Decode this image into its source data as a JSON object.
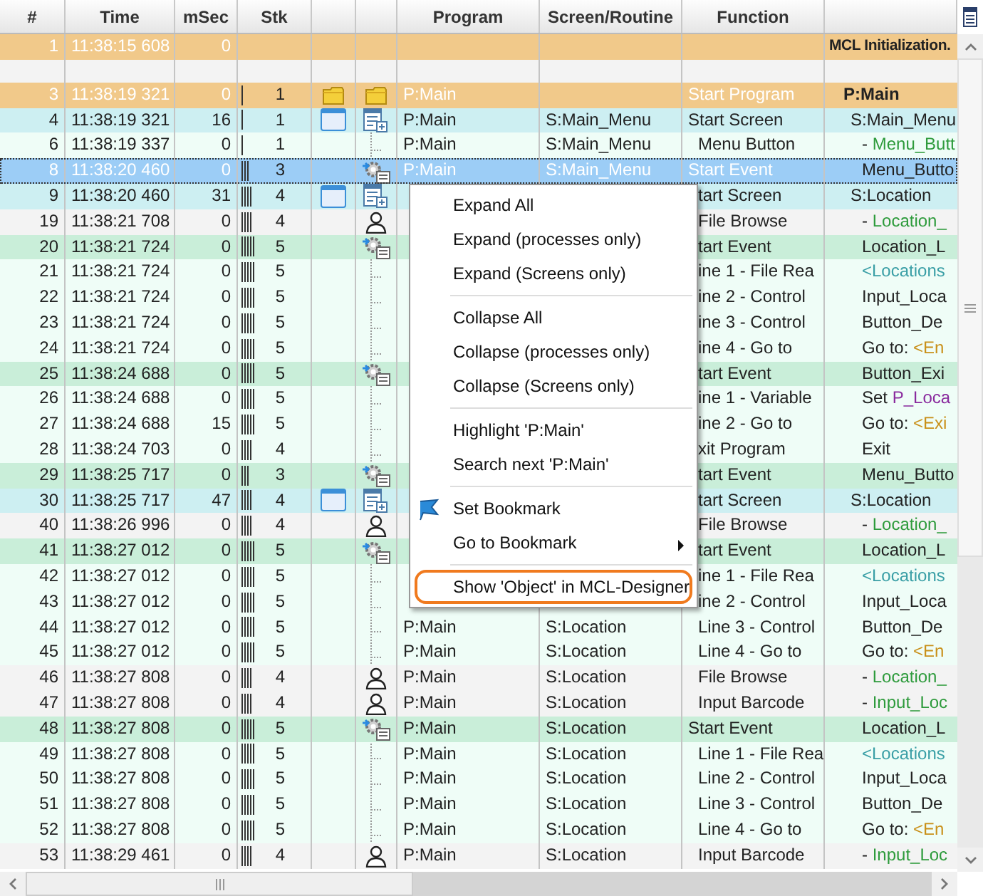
{
  "columns": [
    "#",
    "Time",
    "mSec",
    "Stk",
    "Program",
    "Screen/Routine",
    "Function"
  ],
  "rows": [
    {
      "kind": "init",
      "selected": false,
      "num": "1",
      "time": "11:38:15 608",
      "msec": "0",
      "detail": [
        {
          "text": "MCL Initialization."
        }
      ]
    },
    {
      "kind": "blank",
      "selected": false
    },
    {
      "kind": "program",
      "selected": false,
      "num": "3",
      "time": "11:38:19 321",
      "msec": "0",
      "stk": "1",
      "program": "P:Main",
      "function": {
        "text": "Start Program",
        "indented": false
      },
      "detail": [
        {
          "text": "P:Main"
        }
      ]
    },
    {
      "kind": "screen",
      "selected": false,
      "num": "4",
      "time": "11:38:19 321",
      "msec": "16",
      "stk": "1",
      "program": "P:Main",
      "screen": "S:Main_Menu",
      "function": {
        "text": "Start Screen",
        "indented": false
      },
      "detail": [
        {
          "text": "S:Main_Menu"
        }
      ]
    },
    {
      "kind": "plain",
      "selected": false,
      "num": "6",
      "time": "11:38:19 337",
      "msec": "0",
      "stk": "1",
      "program": "P:Main",
      "screen": "S:Main_Menu",
      "function": {
        "text": "Menu Button",
        "indented": true
      },
      "detail": [
        {
          "text": "- "
        },
        {
          "text": "Menu_Butt",
          "kind": "name"
        }
      ]
    },
    {
      "kind": "event",
      "selected": true,
      "num": "8",
      "time": "11:38:20 460",
      "msec": "0",
      "stk": "3",
      "program": "P:Main",
      "screen": "S:Main_Menu",
      "function": {
        "text": "Start Event",
        "indented": false
      },
      "detail": [
        {
          "text": "Menu_Butto"
        }
      ]
    },
    {
      "kind": "screen",
      "selected": false,
      "num": "9",
      "time": "11:38:20 460",
      "msec": "31",
      "stk": "4",
      "function": {
        "text": "tart Screen",
        "indented": true
      },
      "detail": [
        {
          "text": "S:Location"
        }
      ]
    },
    {
      "kind": "input",
      "selected": false,
      "num": "19",
      "time": "11:38:21 708",
      "msec": "0",
      "stk": "4",
      "function": {
        "text": "File Browse",
        "indented": true
      },
      "detail": [
        {
          "text": "- "
        },
        {
          "text": "Location_",
          "kind": "name"
        }
      ]
    },
    {
      "kind": "event",
      "selected": false,
      "num": "20",
      "time": "11:38:21 724",
      "msec": "0",
      "stk": "5",
      "function": {
        "text": "tart Event",
        "indented": true
      },
      "detail": [
        {
          "text": "Location_L"
        }
      ]
    },
    {
      "kind": "plain",
      "selected": false,
      "num": "21",
      "time": "11:38:21 724",
      "msec": "0",
      "stk": "5",
      "function": {
        "text": "ine 1 - File Rea",
        "indented": true
      },
      "detail": [
        {
          "text": "<Locations",
          "kind": "list"
        }
      ]
    },
    {
      "kind": "plain",
      "selected": false,
      "num": "22",
      "time": "11:38:21 724",
      "msec": "0",
      "stk": "5",
      "function": {
        "text": "ine 2 - Control",
        "indented": true
      },
      "detail": [
        {
          "text": "Input_Loca"
        }
      ]
    },
    {
      "kind": "plain",
      "selected": false,
      "num": "23",
      "time": "11:38:21 724",
      "msec": "0",
      "stk": "5",
      "function": {
        "text": "ine 3 - Control",
        "indented": true
      },
      "detail": [
        {
          "text": "Button_De"
        }
      ]
    },
    {
      "kind": "plain",
      "selected": false,
      "num": "24",
      "time": "11:38:21 724",
      "msec": "0",
      "stk": "5",
      "function": {
        "text": "ine 4 - Go to",
        "indented": true
      },
      "detail": [
        {
          "text": "Go to: "
        },
        {
          "text": "<En",
          "kind": "target"
        }
      ]
    },
    {
      "kind": "event",
      "selected": false,
      "num": "25",
      "time": "11:38:24 688",
      "msec": "0",
      "stk": "5",
      "function": {
        "text": "tart Event",
        "indented": true
      },
      "detail": [
        {
          "text": "Button_Exi"
        }
      ]
    },
    {
      "kind": "plain",
      "selected": false,
      "num": "26",
      "time": "11:38:24 688",
      "msec": "0",
      "stk": "5",
      "function": {
        "text": "ine 1 - Variable",
        "indented": true
      },
      "detail": [
        {
          "text": "Set "
        },
        {
          "text": "P_Loca",
          "kind": "variable"
        }
      ]
    },
    {
      "kind": "plain",
      "selected": false,
      "num": "27",
      "time": "11:38:24 688",
      "msec": "15",
      "stk": "5",
      "function": {
        "text": "ine 2 - Go to",
        "indented": true
      },
      "detail": [
        {
          "text": "Go to: "
        },
        {
          "text": "<Exi",
          "kind": "target"
        }
      ]
    },
    {
      "kind": "plain",
      "selected": false,
      "num": "28",
      "time": "11:38:24 703",
      "msec": "0",
      "stk": "4",
      "function": {
        "text": "xit Program",
        "indented": true
      },
      "detail": [
        {
          "text": "Exit"
        }
      ]
    },
    {
      "kind": "event",
      "selected": false,
      "num": "29",
      "time": "11:38:25 717",
      "msec": "0",
      "stk": "3",
      "function": {
        "text": "tart Event",
        "indented": true
      },
      "detail": [
        {
          "text": "Menu_Butto"
        }
      ]
    },
    {
      "kind": "screen",
      "selected": false,
      "num": "30",
      "time": "11:38:25 717",
      "msec": "47",
      "stk": "4",
      "function": {
        "text": "tart Screen",
        "indented": true
      },
      "detail": [
        {
          "text": "S:Location"
        }
      ]
    },
    {
      "kind": "input",
      "selected": false,
      "num": "40",
      "time": "11:38:26 996",
      "msec": "0",
      "stk": "4",
      "function": {
        "text": "File Browse",
        "indented": true
      },
      "detail": [
        {
          "text": "- "
        },
        {
          "text": "Location_",
          "kind": "name"
        }
      ]
    },
    {
      "kind": "event",
      "selected": false,
      "num": "41",
      "time": "11:38:27 012",
      "msec": "0",
      "stk": "5",
      "function": {
        "text": "tart Event",
        "indented": true
      },
      "detail": [
        {
          "text": "Location_L"
        }
      ]
    },
    {
      "kind": "plain",
      "selected": false,
      "num": "42",
      "time": "11:38:27 012",
      "msec": "0",
      "stk": "5",
      "function": {
        "text": "ine 1 - File Rea",
        "indented": true
      },
      "detail": [
        {
          "text": "<Locations",
          "kind": "list"
        }
      ]
    },
    {
      "kind": "plain",
      "selected": false,
      "num": "43",
      "time": "11:38:27 012",
      "msec": "0",
      "stk": "5",
      "function": {
        "text": "ine 2 - Control",
        "indented": true
      },
      "detail": [
        {
          "text": "Input_Loca"
        }
      ]
    },
    {
      "kind": "plain",
      "selected": false,
      "num": "44",
      "time": "11:38:27 012",
      "msec": "0",
      "stk": "5",
      "program": "P:Main",
      "screen": "S:Location",
      "function": {
        "text": "Line 3 - Control",
        "indented": true
      },
      "detail": [
        {
          "text": "Button_De"
        }
      ]
    },
    {
      "kind": "plain",
      "selected": false,
      "num": "45",
      "time": "11:38:27 012",
      "msec": "0",
      "stk": "5",
      "program": "P:Main",
      "screen": "S:Location",
      "function": {
        "text": "Line 4 - Go to",
        "indented": true
      },
      "detail": [
        {
          "text": "Go to: "
        },
        {
          "text": "<En",
          "kind": "target"
        }
      ]
    },
    {
      "kind": "input",
      "selected": false,
      "num": "46",
      "time": "11:38:27 808",
      "msec": "0",
      "stk": "4",
      "program": "P:Main",
      "screen": "S:Location",
      "function": {
        "text": "File Browse",
        "indented": true
      },
      "detail": [
        {
          "text": "- "
        },
        {
          "text": "Location_",
          "kind": "name"
        }
      ]
    },
    {
      "kind": "input",
      "selected": false,
      "num": "47",
      "time": "11:38:27 808",
      "msec": "0",
      "stk": "4",
      "program": "P:Main",
      "screen": "S:Location",
      "function": {
        "text": "Input Barcode",
        "indented": true
      },
      "detail": [
        {
          "text": "- "
        },
        {
          "text": "Input_Loc",
          "kind": "name"
        }
      ]
    },
    {
      "kind": "event",
      "selected": false,
      "num": "48",
      "time": "11:38:27 808",
      "msec": "0",
      "stk": "5",
      "program": "P:Main",
      "screen": "S:Location",
      "function": {
        "text": "Start Event",
        "indented": false
      },
      "detail": [
        {
          "text": "Location_L"
        }
      ]
    },
    {
      "kind": "plain",
      "selected": false,
      "num": "49",
      "time": "11:38:27 808",
      "msec": "0",
      "stk": "5",
      "program": "P:Main",
      "screen": "S:Location",
      "function": {
        "text": "Line 1 - File Rea",
        "indented": true
      },
      "detail": [
        {
          "text": "<Locations",
          "kind": "list"
        }
      ]
    },
    {
      "kind": "plain",
      "selected": false,
      "num": "50",
      "time": "11:38:27 808",
      "msec": "0",
      "stk": "5",
      "program": "P:Main",
      "screen": "S:Location",
      "function": {
        "text": "Line 2 - Control",
        "indented": true
      },
      "detail": [
        {
          "text": "Input_Loca"
        }
      ]
    },
    {
      "kind": "plain",
      "selected": false,
      "num": "51",
      "time": "11:38:27 808",
      "msec": "0",
      "stk": "5",
      "program": "P:Main",
      "screen": "S:Location",
      "function": {
        "text": "Line 3 - Control",
        "indented": true
      },
      "detail": [
        {
          "text": "Button_De"
        }
      ]
    },
    {
      "kind": "plain",
      "selected": false,
      "num": "52",
      "time": "11:38:27 808",
      "msec": "0",
      "stk": "5",
      "program": "P:Main",
      "screen": "S:Location",
      "function": {
        "text": "Line 4 - Go to",
        "indented": true
      },
      "detail": [
        {
          "text": "Go to: "
        },
        {
          "text": "<En",
          "kind": "target"
        }
      ]
    },
    {
      "kind": "input",
      "selected": false,
      "num": "53",
      "time": "11:38:29 461",
      "msec": "0",
      "stk": "4",
      "program": "P:Main",
      "screen": "S:Location",
      "function": {
        "text": "Input Barcode",
        "indented": true
      },
      "detail": [
        {
          "text": "- "
        },
        {
          "text": "Input_Loc",
          "kind": "name"
        }
      ]
    }
  ],
  "context_menu": {
    "items": [
      {
        "kind": "item",
        "label": "Expand All",
        "highlighted": false
      },
      {
        "kind": "item",
        "label": "Expand (processes only)",
        "highlighted": false
      },
      {
        "kind": "item",
        "label": "Expand (Screens only)",
        "highlighted": false
      },
      {
        "kind": "separator"
      },
      {
        "kind": "item",
        "label": "Collapse All",
        "highlighted": false
      },
      {
        "kind": "item",
        "label": "Collapse (processes only)",
        "highlighted": false
      },
      {
        "kind": "item",
        "label": "Collapse (Screens only)",
        "highlighted": false
      },
      {
        "kind": "separator"
      },
      {
        "kind": "item",
        "label": "Highlight  'P:Main'",
        "highlighted": false
      },
      {
        "kind": "item",
        "label": "Search next  'P:Main'",
        "highlighted": false
      },
      {
        "kind": "separator"
      },
      {
        "kind": "bookmark",
        "label": "Set Bookmark",
        "highlighted": false
      },
      {
        "kind": "item",
        "label": "Go to Bookmark",
        "submenu": true,
        "highlighted": false
      },
      {
        "kind": "separator"
      },
      {
        "kind": "item",
        "label": "Show 'Object' in MCL-Designer",
        "highlighted": true
      }
    ]
  }
}
